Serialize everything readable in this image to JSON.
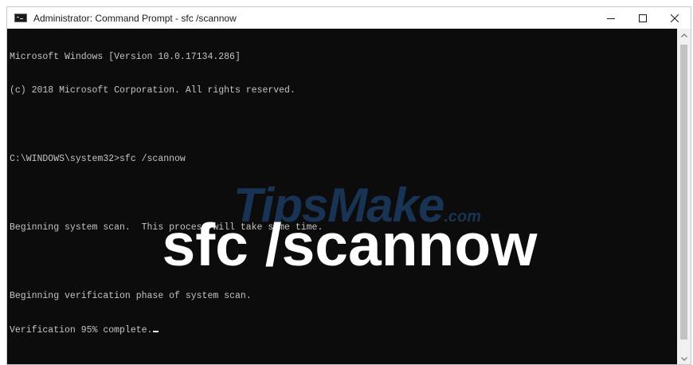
{
  "window": {
    "title": "Administrator: Command Prompt - sfc  /scannow",
    "controls": {
      "minimize_icon": "minimize-icon",
      "maximize_icon": "maximize-icon",
      "close_icon": "close-icon"
    }
  },
  "console": {
    "lines": [
      "Microsoft Windows [Version 10.0.17134.286]",
      "(c) 2018 Microsoft Corporation. All rights reserved.",
      "",
      "C:\\WINDOWS\\system32>sfc /scannow",
      "",
      "Beginning system scan.  This process will take some time.",
      "",
      "Beginning verification phase of system scan.",
      "Verification 95% complete."
    ],
    "colors": {
      "background": "#0c0c0c",
      "text": "#c4c4c4"
    }
  },
  "watermark": {
    "brand": "TipsMake",
    "suffix": ".com"
  },
  "caption": {
    "text": "sfc /scannow"
  }
}
